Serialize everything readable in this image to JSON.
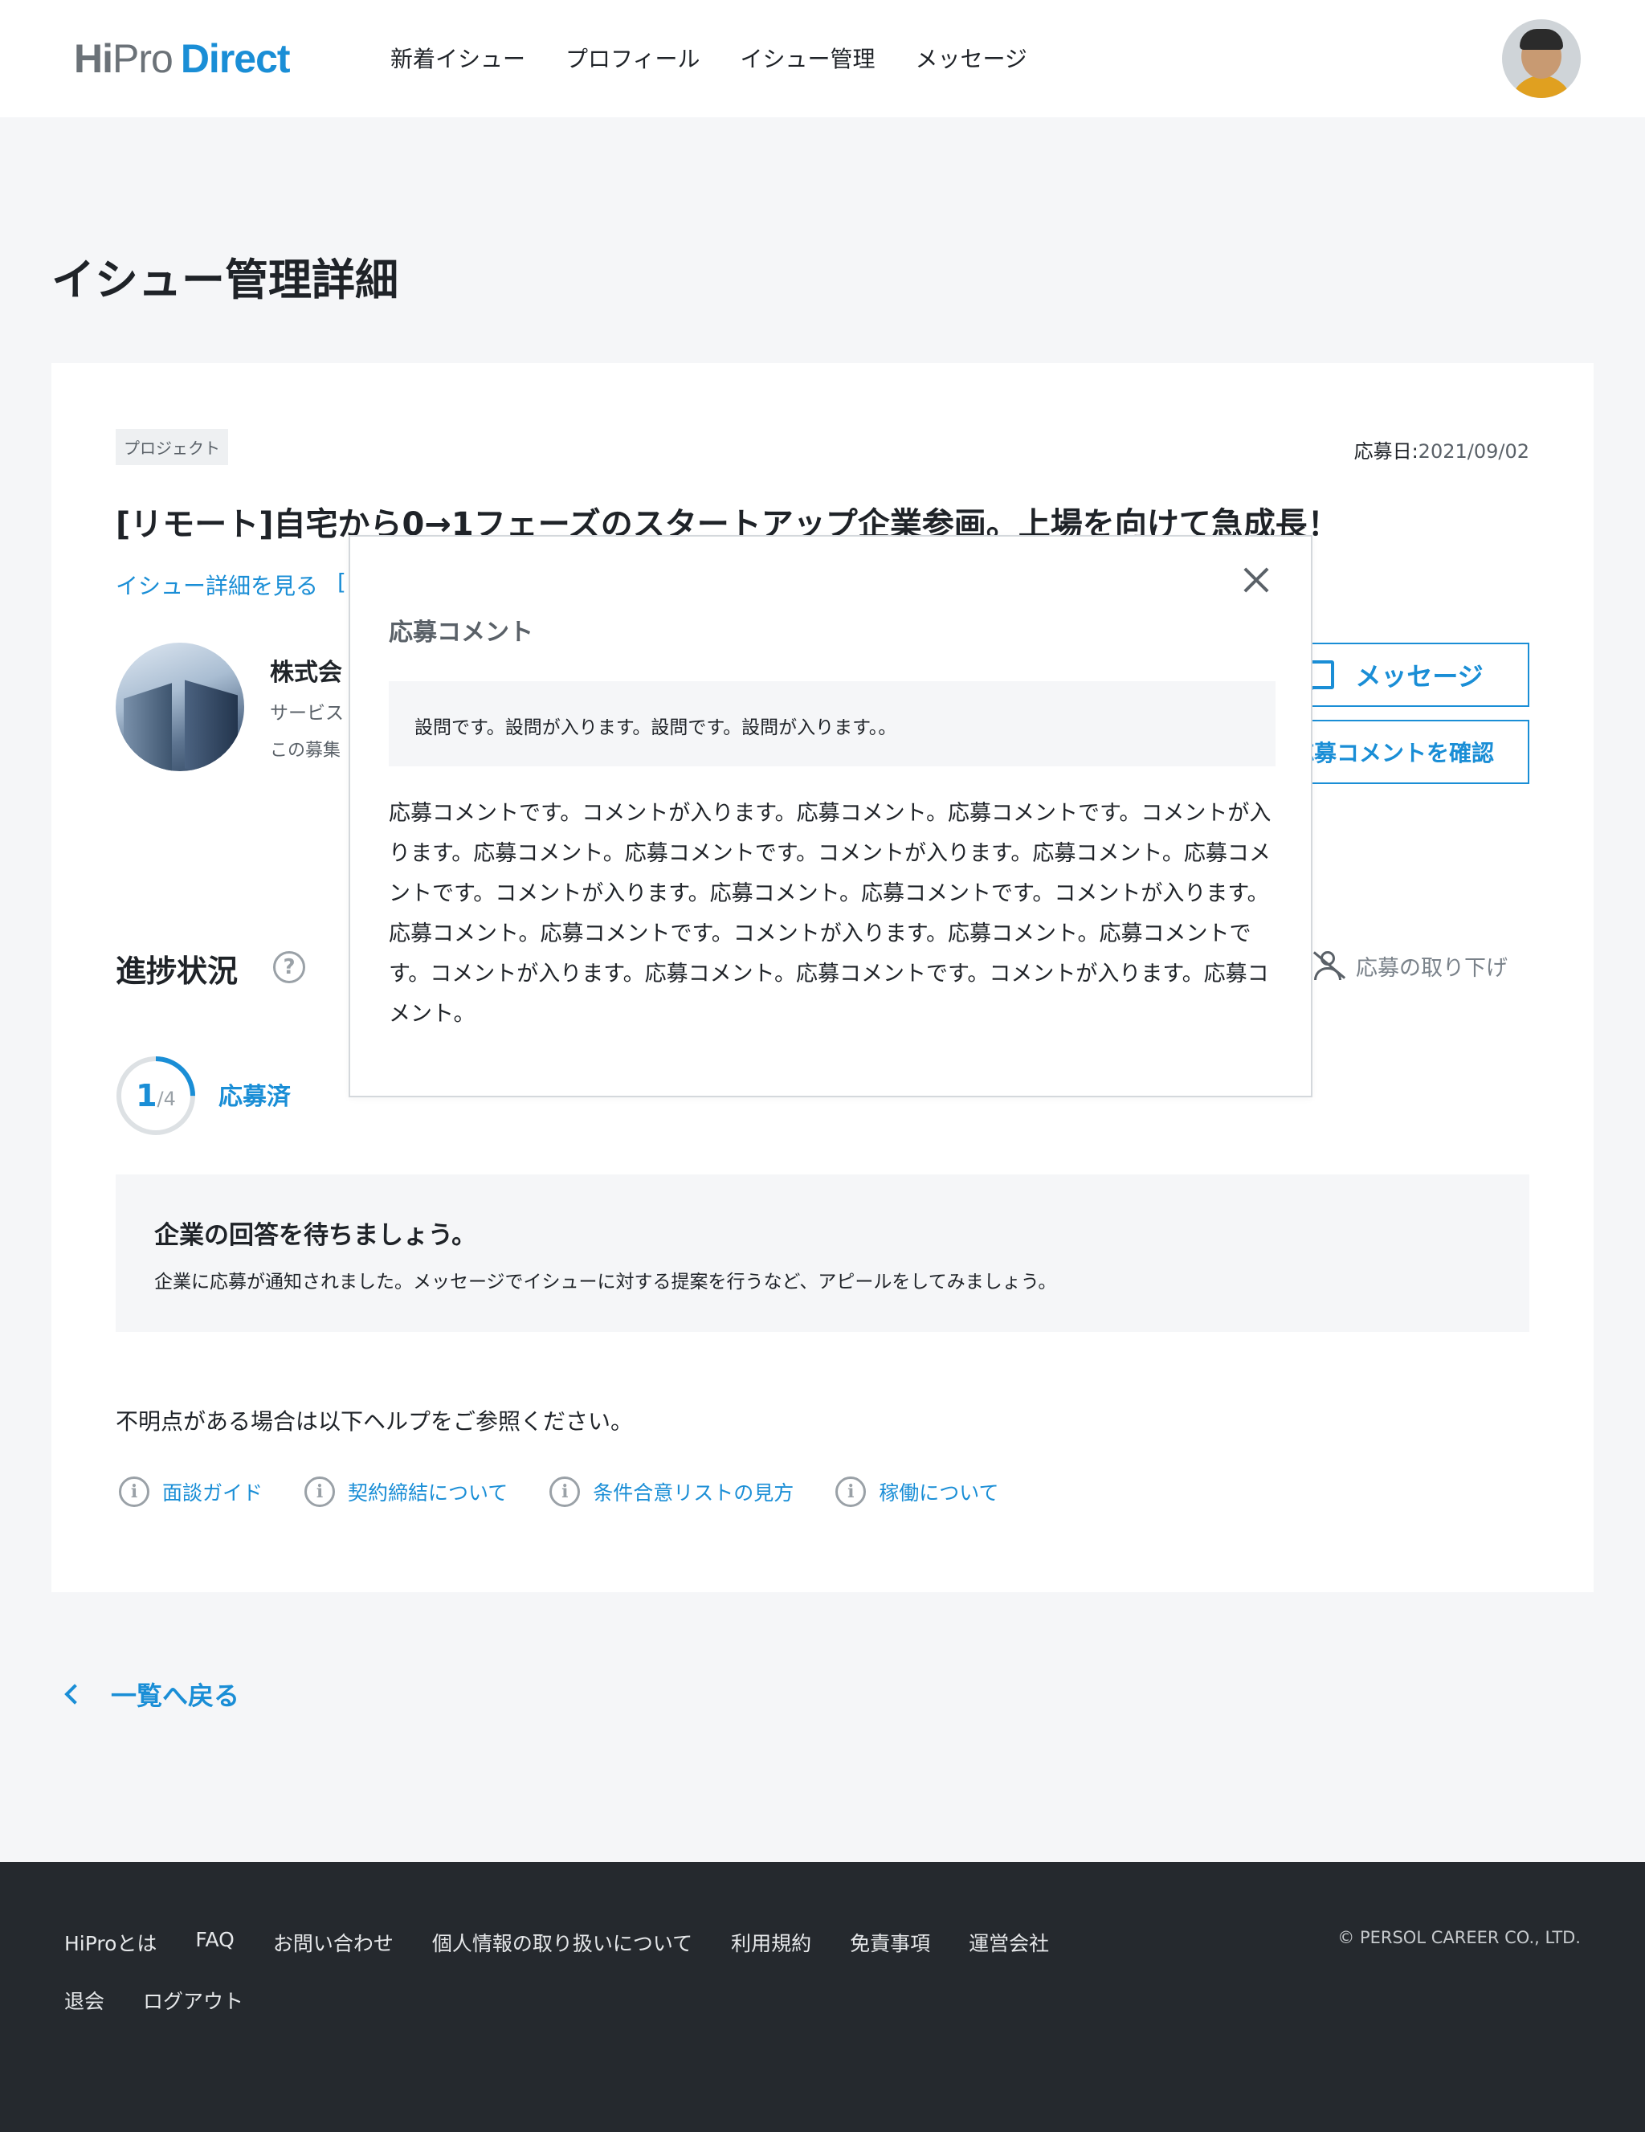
{
  "header": {
    "logo": {
      "hi": "Hi",
      "pro": "Pro",
      "direct": "Direct"
    },
    "nav": [
      "新着イシュー",
      "プロフィール",
      "イシュー管理",
      "メッセージ"
    ]
  },
  "page_title": "イシュー管理詳細",
  "card": {
    "tag": "プロジェクト",
    "apply_date_label": "応募日:",
    "apply_date_value": "2021/09/02",
    "issue_title": "[リモート]自宅から0→1フェーズのスタートアップ企業参画。上場を向けて急成長！",
    "detail_link": "イシュー詳細を見る",
    "detail_bracket": "[",
    "company_name": "株式会",
    "company_sub": "サービス",
    "company_note": "この募集",
    "message_button": "メッセージ",
    "comment_button": "応募コメントを確認",
    "progress_title": "進捗状況",
    "help_icon": "?",
    "withdraw_label": "応募の取り下げ",
    "progress": {
      "current": "1",
      "total": "/4",
      "fraction": 0.25
    },
    "status_label": "応募済",
    "info_title": "企業の回答を待ちましょう。",
    "info_body": "企業に応募が通知されました。メッセージでイシューに対する提案を行うなど、アピールをしてみましょう。",
    "help_text": "不明点がある場合は以下ヘルプをご参照ください。",
    "help_links": [
      "面談ガイド",
      "契約締結について",
      "条件合意リストの見方",
      "稼働について"
    ],
    "info_icon_glyph": "i"
  },
  "back_link": "一覧へ戻る",
  "footer": {
    "links_row1": [
      "HiProとは",
      "FAQ",
      "お問い合わせ",
      "個人情報の取り扱いについて",
      "利用規約",
      "免責事項",
      "運営会社"
    ],
    "links_row2": [
      "退会",
      "ログアウト"
    ],
    "copyright": "© PERSOL CAREER CO., LTD."
  },
  "modal": {
    "title": "応募コメント",
    "question": "設問です。設問が入ります。設問です。設問が入ります。。",
    "comment": "応募コメントです。コメントが入ります。応募コメント。応募コメントです。コメントが入ります。応募コメント。応募コメントです。コメントが入ります。応募コメント。応募コメントです。コメントが入ります。応募コメント。応募コメントです。コメントが入ります。応募コメント。応募コメントです。コメントが入ります。応募コメント。応募コメントです。コメントが入ります。応募コメント。応募コメントです。コメントが入ります。応募コメント。"
  },
  "colors": {
    "accent": "#1a8ed6",
    "footer_bg": "#25292e",
    "page_bg": "#f5f6f8"
  }
}
